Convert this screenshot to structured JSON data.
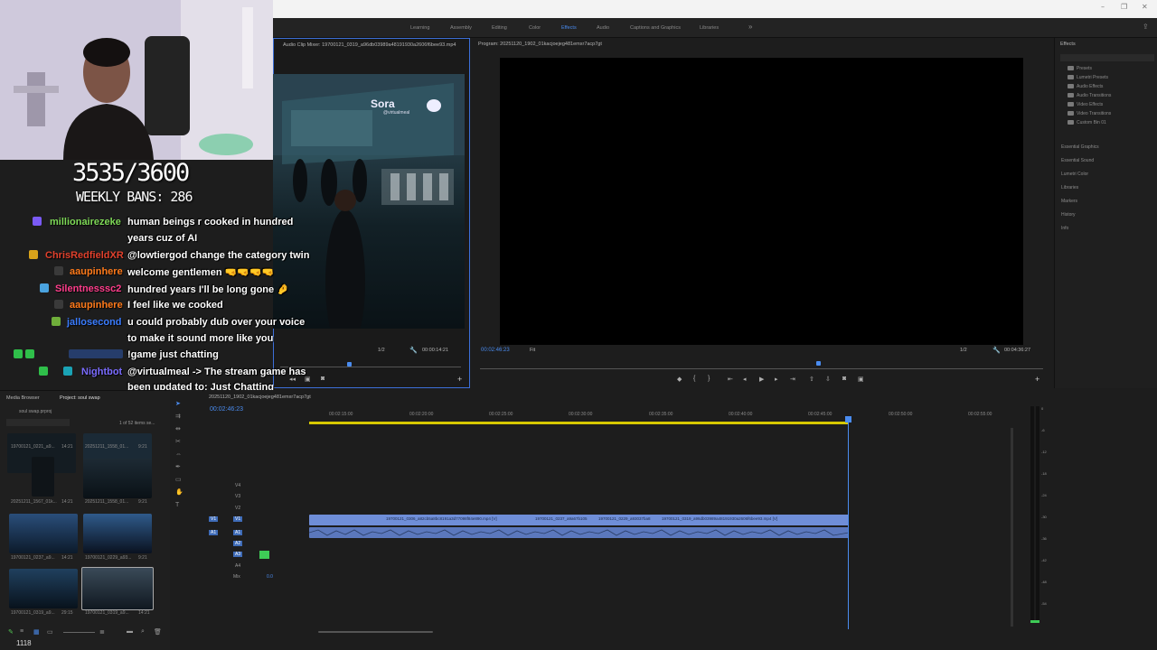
{
  "workspaces": [
    {
      "label": "Learning",
      "active": false
    },
    {
      "label": "Assembly",
      "active": false
    },
    {
      "label": "Editing",
      "active": false
    },
    {
      "label": "Color",
      "active": false
    },
    {
      "label": "Effects",
      "active": true
    },
    {
      "label": "Audio",
      "active": false
    },
    {
      "label": "Captions and Graphics",
      "active": false
    },
    {
      "label": "Libraries",
      "active": false
    }
  ],
  "window_controls": {
    "min": "–",
    "max": "❐",
    "close": "✕"
  },
  "source": {
    "title": "Audio Clip Mixer: 19700121_0319_a96db03989a48191930a2606f6bee93.mp4",
    "timecode_left": "",
    "zoom": "1/2",
    "timecode_right": "00:00:14:21"
  },
  "program": {
    "title": "Program: 20251120_1902_01kacjoejeg481emxr7acp7gt",
    "timecode": "00:02:46:23",
    "fit": "Fit",
    "zoom": "1/2",
    "duration": "00:04:36:27"
  },
  "effects_panel": {
    "title": "Effects",
    "folders": [
      "Presets",
      "Lumetri Presets",
      "Audio Effects",
      "Audio Transitions",
      "Video Effects",
      "Video Transitions",
      "Custom Bin 01"
    ],
    "sections": [
      "Essential Graphics",
      "Essential Sound",
      "Lumetri Color",
      "Libraries",
      "Markers",
      "History",
      "Info"
    ]
  },
  "project": {
    "tab_media": "Media Browser",
    "tab_project": "Project: soul swap",
    "file": "soul swap.prproj",
    "count": "1 of 52 items se...",
    "items": [
      {
        "name": "19700121_0221_a9...",
        "dur": "14:21"
      },
      {
        "name": "20251211_1558_01...",
        "dur": "9:21"
      },
      {
        "name": "20251211_1567_01k...",
        "dur": "14:21"
      },
      {
        "name": "20251211_1558_01...",
        "dur": "9:21"
      },
      {
        "name": "19700121_0237_a9...",
        "dur": "14:21"
      },
      {
        "name": "19700121_0229_a93...",
        "dur": "9:21"
      },
      {
        "name": "19700121_0319_a9...",
        "dur": "29:15"
      },
      {
        "name": "19700121_0319_a9...",
        "dur": "14:21"
      }
    ],
    "zoom_value": "1118"
  },
  "timeline": {
    "sequence_name": "20251120_1902_01kacjoejeg481emxr7acp7gt",
    "timecode": "00:02:46:23",
    "ruler": [
      "00:02:15:00",
      "00:02:20:00",
      "00:02:25:00",
      "00:02:30:00",
      "00:02:35:00",
      "00:02:40:00",
      "00:02:45:00",
      "00:02:50:00",
      "00:02:55:00"
    ],
    "video_tracks": [
      "V4",
      "V3",
      "V2",
      "V1"
    ],
    "audio_tracks": [
      "A1",
      "A2",
      "A3",
      "A4"
    ],
    "mix_label": "Mix",
    "mix_value": "0.0",
    "clips": [
      "19700121_0306_a82cb5a8bc8191a3d77098f84e890.mp4 [V]",
      "19700121_0237_a9a67b105",
      "19700121_0229_a93037ba8",
      "19700121_0319_a96db03989a48191930a2606f6bee93.mp4 [V]"
    ]
  },
  "overlay": {
    "counter": "3535/3600",
    "weekly": "WEEKLY BANS: 286",
    "sora_logo": "Sora",
    "sora_user": "@virtualmeal",
    "chat": [
      {
        "user": "millionairezeke",
        "color": "#7ed957",
        "text": "human beings r cooked in hundred"
      },
      {
        "user": "",
        "color": "#ffffff",
        "text": "years cuz of AI"
      },
      {
        "user": "ChrisRedfieldXR",
        "color": "#e0402c",
        "text": "@lowtiergod change the category twin"
      },
      {
        "user": "aaupinhere",
        "color": "#ff7a1a",
        "text": "welcome gentlemen 🤜🤜🤜🤜"
      },
      {
        "user": "Silentnesssc2",
        "color": "#ff3d8b",
        "text": "hundred years I'll be long gone 🤌"
      },
      {
        "user": "aaupinhere",
        "color": "#ff7a1a",
        "text": "I feel like we cooked"
      },
      {
        "user": "jallosecond",
        "color": "#3a7cff",
        "text": "u could probably dub over your voice"
      },
      {
        "user": "",
        "color": "#ffffff",
        "text": "to make it sound more like you"
      },
      {
        "user": "",
        "color": "#3a7cff",
        "text": "!game just chatting"
      },
      {
        "user": "Nightbot",
        "color": "#7a6bff",
        "text": "@virtualmeal -> The stream game has"
      },
      {
        "user": "",
        "color": "#ffffff",
        "text": "been updated to: Just Chatting"
      }
    ]
  },
  "meters": [
    "0",
    "-6",
    "-12",
    "-18",
    "-24",
    "-30",
    "-36",
    "-42",
    "-48",
    "-54"
  ]
}
